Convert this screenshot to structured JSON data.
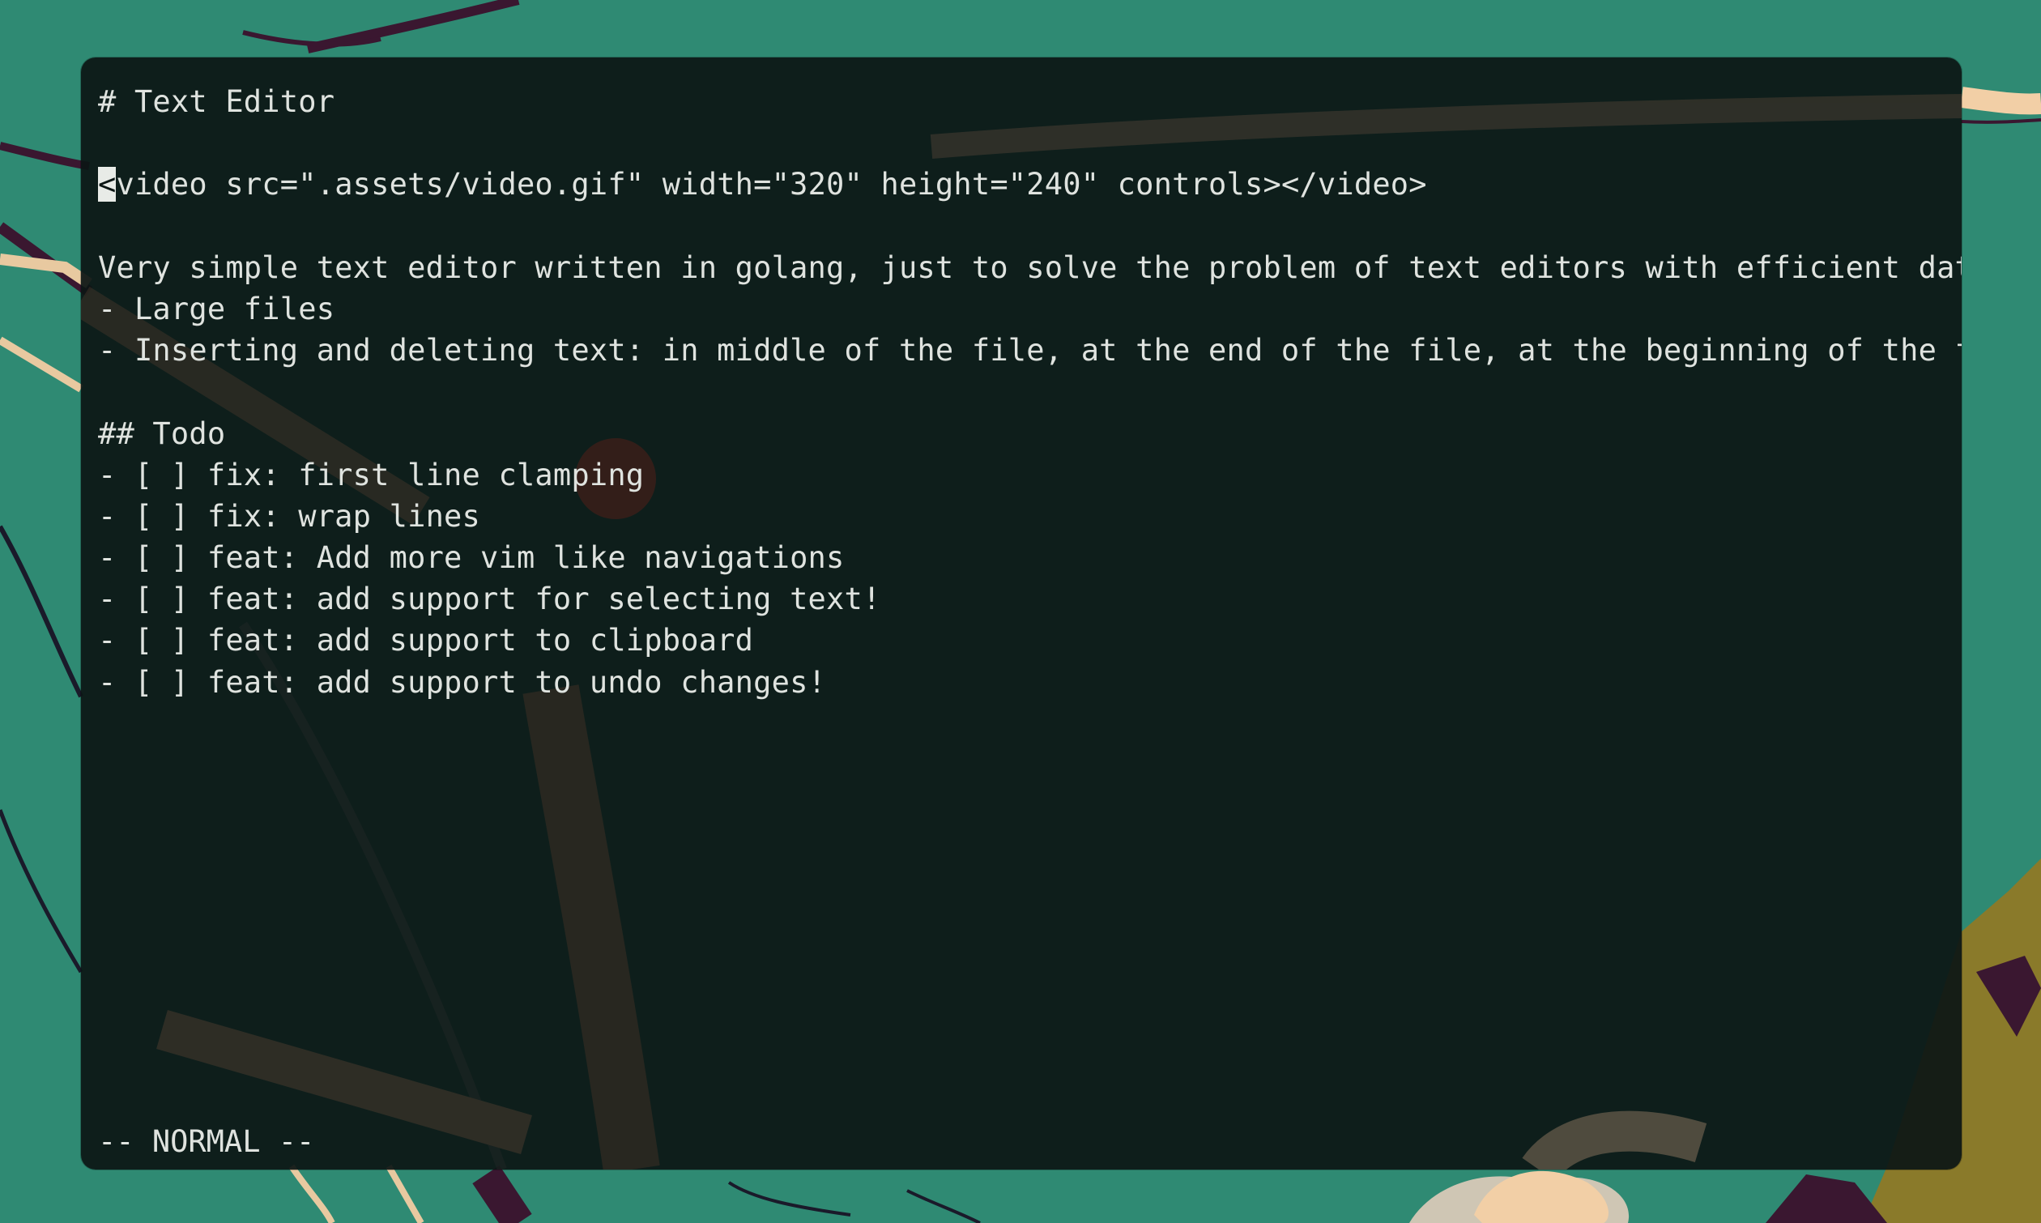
{
  "editor": {
    "lines": [
      "# Text Editor",
      "",
      "<video src=\".assets/video.gif\" width=\"320\" height=\"240\" controls></video>",
      "",
      "Very simple text editor written in golang, just to solve the problem of text editors with efficient data structure",
      "- Large files",
      "- Inserting and deleting text: in middle of the file, at the end of the file, at the beginning of the file",
      "",
      "## Todo",
      "- [ ] fix: first line clamping",
      "- [ ] fix: wrap lines",
      "- [ ] feat: Add more vim like navigations",
      "- [ ] feat: add support for selecting text!",
      "- [ ] feat: add support to clipboard",
      "- [ ] feat: add support to undo changes!"
    ],
    "cursor_line_char": "<",
    "cursor_line_rest": "video src=\".assets/video.gif\" width=\"320\" height=\"240\" controls></video>",
    "mode": "-- NORMAL --"
  },
  "colors": {
    "desktop_background": "#2f8a73",
    "terminal_background": "#0c1614",
    "text": "#dfe3df",
    "cursor": "#e8ebe7"
  }
}
